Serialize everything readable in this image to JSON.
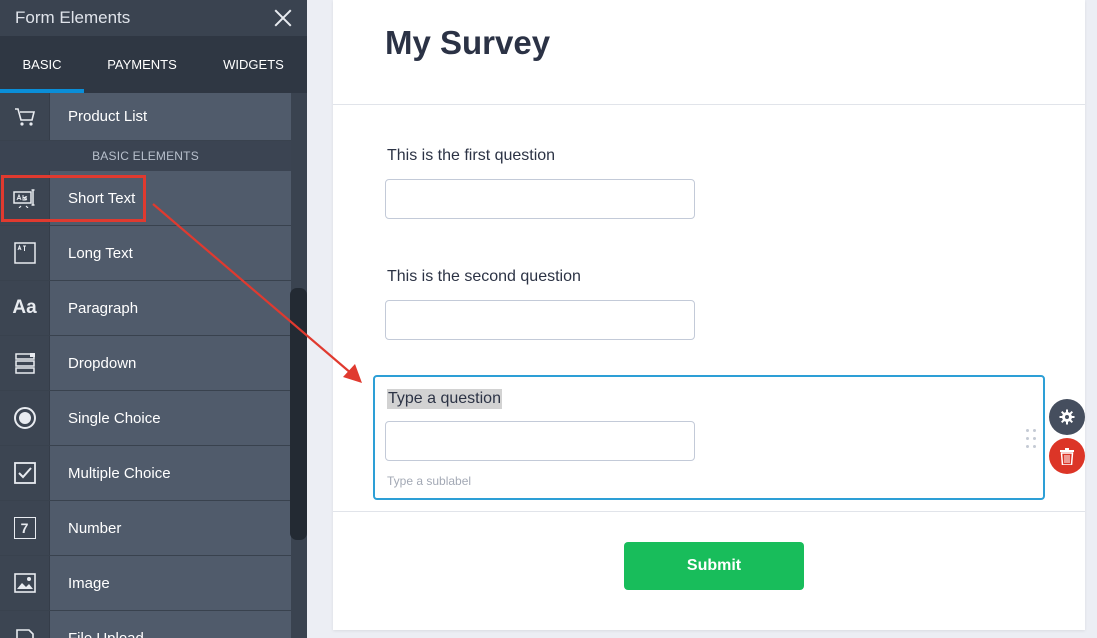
{
  "sidebar": {
    "title": "Form Elements",
    "tabs": [
      "BASIC",
      "PAYMENTS",
      "WIDGETS"
    ],
    "active_tab": "BASIC",
    "top_item": "Product List",
    "section_label": "BASIC ELEMENTS",
    "items": [
      {
        "label": "Short Text",
        "icon": "short-text-icon"
      },
      {
        "label": "Long Text",
        "icon": "long-text-icon"
      },
      {
        "label": "Paragraph",
        "icon": "paragraph-icon"
      },
      {
        "label": "Dropdown",
        "icon": "dropdown-icon"
      },
      {
        "label": "Single Choice",
        "icon": "radio-icon"
      },
      {
        "label": "Multiple Choice",
        "icon": "checkbox-icon"
      },
      {
        "label": "Number",
        "icon": "number-icon"
      },
      {
        "label": "Image",
        "icon": "image-icon"
      },
      {
        "label": "File Upload",
        "icon": "file-upload-icon"
      }
    ],
    "icon_glyphs": {
      "paragraph": "Aa",
      "number": "7"
    }
  },
  "form": {
    "title": "My Survey",
    "questions": [
      {
        "label": "This is the first question"
      },
      {
        "label": "This is the second question"
      }
    ],
    "active_question": {
      "label": "Type a question",
      "sublabel": "Type a sublabel"
    },
    "submit_label": "Submit"
  },
  "colors": {
    "highlight": "#e03a2f",
    "active_border": "#2d9fd6",
    "submit": "#18bd5b",
    "delete": "#dc3527",
    "tab_indicator": "#0a8ed8"
  }
}
